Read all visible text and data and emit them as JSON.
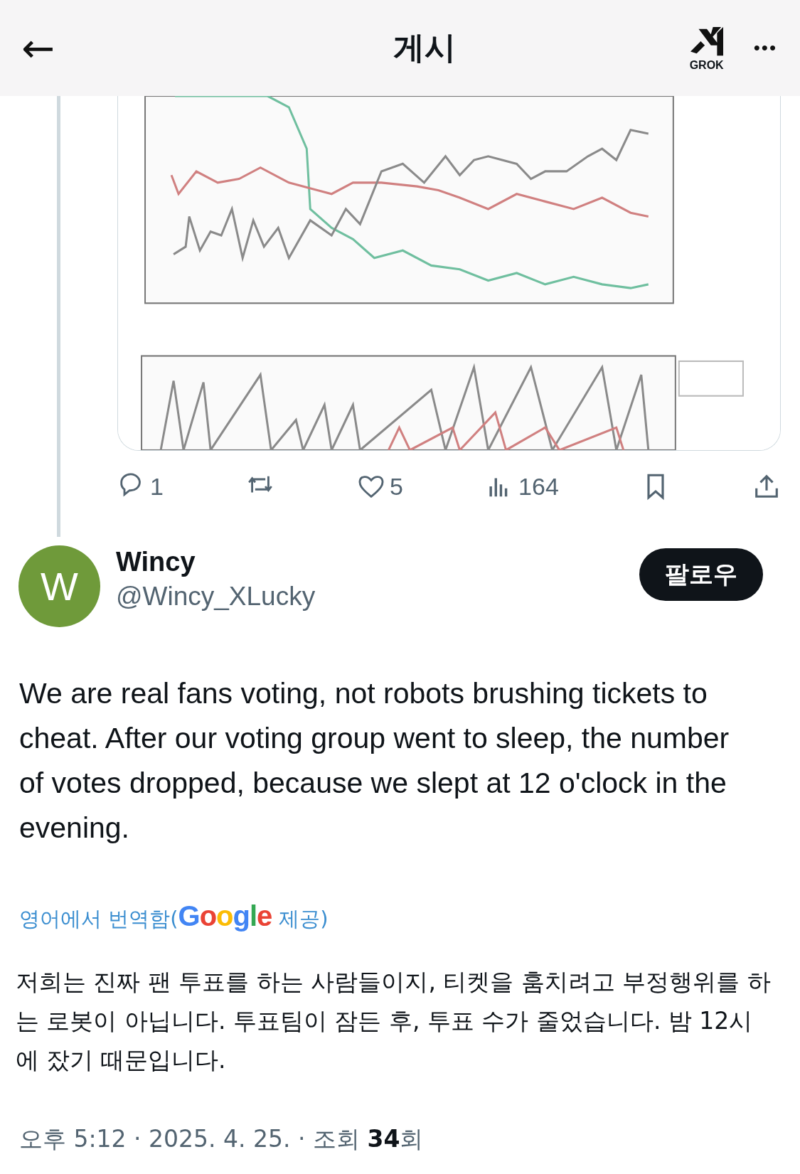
{
  "header": {
    "back": "←",
    "title": "게시",
    "grok_label": "GROK",
    "more": "•••"
  },
  "actions": [
    {
      "kind": "reply",
      "count": "1"
    },
    {
      "kind": "repost"
    },
    {
      "kind": "like",
      "count": "5"
    },
    {
      "kind": "views",
      "count": "164"
    },
    {
      "kind": "bookmark"
    },
    {
      "kind": "share"
    }
  ],
  "author": {
    "initial": "W",
    "name": "Wincy",
    "handle": "@Wincy_XLucky",
    "follow": "팔로우"
  },
  "text": "We are real fans voting, not robots brushing tickets to cheat. After our voting group went to sleep, the number of votes dropped, because we slept at 12 o'clock in the evening.",
  "translation": {
    "label": "영어에서 번역함(",
    "brand": "Google",
    "suffix": "제공)",
    "text": "저희는 진짜 팬 투표를 하는 사람들이지, 티켓을 훔치려고 부정행위를 하는 로봇이 아닙니다. 투표팀이 잠든 후, 투표 수가 줄었습니다. 밤 12시에 잤기 때문입니다."
  },
  "footer": "오후 5:12 · 2025. 4. 25. · 조회 **34**회"
}
